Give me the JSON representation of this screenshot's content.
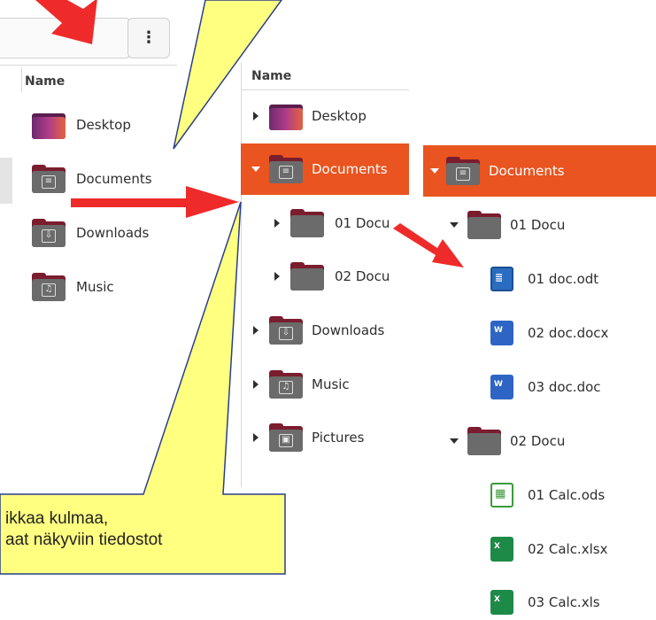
{
  "toolbar": {
    "menu_glyph": "⋮"
  },
  "panel1": {
    "header": "Name",
    "items": [
      {
        "label": "Desktop",
        "icon": "desktop-folder-icon"
      },
      {
        "label": "Documents",
        "icon": "documents-folder-icon"
      },
      {
        "label": "Downloads",
        "icon": "downloads-folder-icon"
      },
      {
        "label": "Music",
        "icon": "music-folder-icon"
      }
    ]
  },
  "panel2": {
    "header": "Name",
    "items": [
      {
        "label": "Desktop"
      },
      {
        "label": "Documents"
      },
      {
        "label": "01 Docu"
      },
      {
        "label": "02 Docu"
      },
      {
        "label": "Downloads"
      },
      {
        "label": "Music"
      },
      {
        "label": "Pictures"
      }
    ]
  },
  "panel3": {
    "items": [
      {
        "label": "Documents"
      },
      {
        "label": "01 Docu"
      },
      {
        "label": "01 doc.odt"
      },
      {
        "label": "02 doc.docx"
      },
      {
        "label": "03 doc.doc"
      },
      {
        "label": "02 Docu"
      },
      {
        "label": "01 Calc.ods"
      },
      {
        "label": "02 Calc.xlsx"
      },
      {
        "label": "03 Calc.xls"
      }
    ]
  },
  "callout": {
    "line1": "ikkaa kulmaa,",
    "line2": "aat näkyviin tiedostot"
  },
  "colors": {
    "accent": "#e95420",
    "folder_tab": "#7a1d2e",
    "folder_body": "#6b6b6b",
    "callout_fill": "#ffff80",
    "callout_border": "#2a3f8a",
    "arrow": "#ee2a2a"
  }
}
